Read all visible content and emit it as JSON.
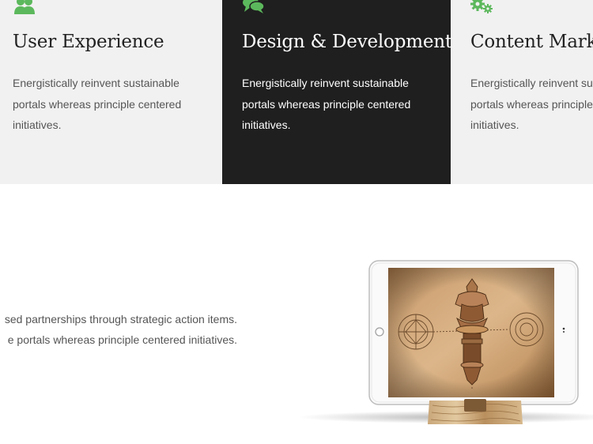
{
  "features": [
    {
      "title": "User Experience",
      "text": "Energistically reinvent sustainable portals whereas principle centered initiatives.",
      "icon": "users-icon",
      "theme": "light"
    },
    {
      "title": "Design & Development",
      "text": "Energistically reinvent sustainable portals whereas principle centered initiatives.",
      "icon": "chat-icon",
      "theme": "dark"
    },
    {
      "title": "Content Marketing",
      "text": "Energistically reinvent sustainable portals whereas principle centered initiatives.",
      "icon": "gears-icon",
      "theme": "light"
    }
  ],
  "about": {
    "line1": "sed partnerships through strategic action items.",
    "line2": "e portals whereas principle centered initiatives."
  },
  "colors": {
    "accent": "#5cb85c",
    "dark_panel": "#1f1f1f",
    "light_panel": "#f1f1f1"
  },
  "image": {
    "name": "tablet-mockup",
    "subject": "tablet-on-wooden-stand"
  }
}
